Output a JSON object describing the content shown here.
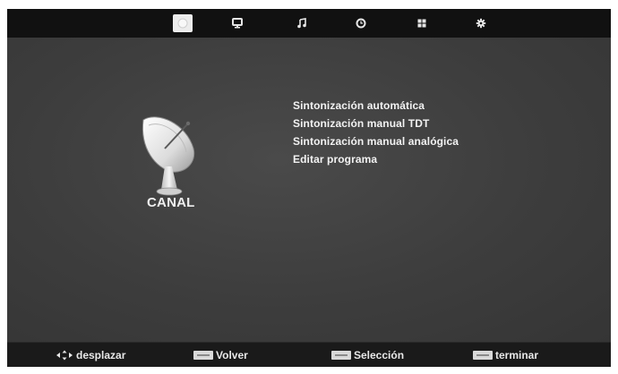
{
  "top_tabs": [
    {
      "icon": "satellite-dish-icon",
      "active": true
    },
    {
      "icon": "monitor-icon",
      "active": false
    },
    {
      "icon": "music-note-icon",
      "active": false
    },
    {
      "icon": "clock-icon",
      "active": false
    },
    {
      "icon": "lock-icon",
      "active": false
    },
    {
      "icon": "gear-icon",
      "active": false
    }
  ],
  "section": {
    "title": "CANAL",
    "icon": "satellite-dish-icon"
  },
  "menu": {
    "items": [
      "Sintonización automática",
      "Sintonización manual TDT",
      "Sintonización manual analógica",
      "Editar programa"
    ]
  },
  "footer": {
    "navigate_label": "desplazar",
    "navigate_icon": "arrows-icon",
    "back_key": "menu-key-icon",
    "back_label": "Volver",
    "select_key": "ok-key-icon",
    "select_label": "Selección",
    "exit_key": "exit-key-icon",
    "exit_label": "terminar"
  },
  "colors": {
    "background": "#3c3c3c",
    "topbar": "#111111",
    "bottombar": "#1a1a1a",
    "text": "#f2f2f2"
  }
}
